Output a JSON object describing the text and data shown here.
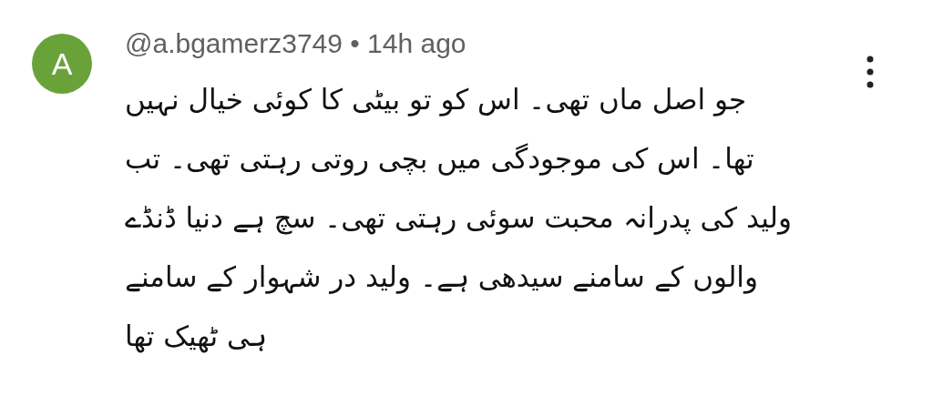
{
  "comment": {
    "avatar_letter": "A",
    "byline": "@a.bgamerz3749 • 14h ago",
    "text": "جو اصل ماں تھی۔ اس کو تو بیٹی  کا کوئی خیال نہیں تھا۔ اس کی موجودگی میں بچی روتی رہتی تھی۔ تب ولید کی پدرانہ محبت سوئی رہتی تھی۔ سچ ہے دنیا ڈنڈے والوں کے سامنے سیدھی ہے۔ ولید در شہوار کے سامنے ہی ٹھیک تھا"
  }
}
